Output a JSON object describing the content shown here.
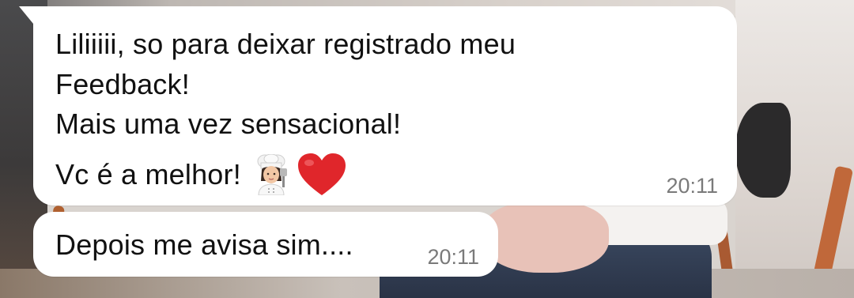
{
  "messages": [
    {
      "lines": [
        "Liliiiii, so para deixar registrado meu",
        "Feedback!",
        "Mais uma vez sensacional!",
        "Vc é a melhor!"
      ],
      "emojis": [
        "chef-woman-emoji",
        "red-heart-emoji"
      ],
      "time": "20:11"
    },
    {
      "lines": [
        "Depois me avisa sim...."
      ],
      "time": "20:11"
    }
  ],
  "colors": {
    "bubble": "#ffffff",
    "text": "#111111",
    "timestamp": "#7a7a7a",
    "heart": "#e0262b"
  }
}
